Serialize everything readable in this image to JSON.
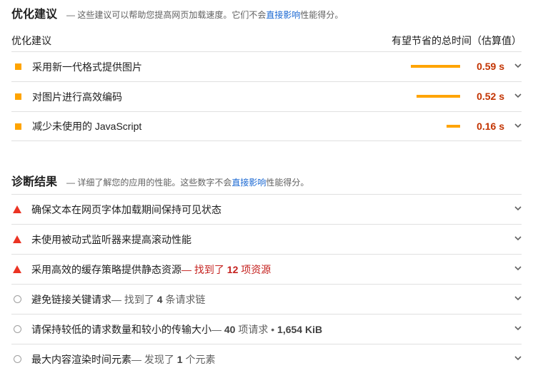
{
  "opportunities": {
    "title": "优化建议",
    "desc_before": "— 这些建议可以帮助您提高网页加载速度。它们不会",
    "desc_link": "直接影响",
    "desc_after": "性能得分。",
    "col_left": "优化建议",
    "col_right": "有望节省的总时间（估算值）",
    "items": [
      {
        "label": "采用新一代格式提供图片",
        "saving": "0.59 s",
        "savings_seconds": 0.59
      },
      {
        "label": "对图片进行高效编码",
        "saving": "0.52 s",
        "savings_seconds": 0.52
      },
      {
        "label": "减少未使用的 JavaScript",
        "saving": "0.16 s",
        "savings_seconds": 0.16
      }
    ],
    "status_color": "#ffa400",
    "saving_text_color": "#c33300"
  },
  "diagnostics": {
    "title": "诊断结果",
    "desc_before": "— 详细了解您的应用的性能。这些数字不会",
    "desc_link": "直接影响",
    "desc_after": "性能得分。",
    "items": [
      {
        "icon": "fail-triangle-icon",
        "label": "确保文本在网页字体加载期间保持可见状态"
      },
      {
        "icon": "fail-triangle-icon",
        "label": "未使用被动式监听器来提高滚动性能"
      },
      {
        "icon": "fail-triangle-icon",
        "label": "采用高效的缓存策略提供静态资源",
        "suffix_pre": " — 找到了 ",
        "suffix_num": "12",
        "suffix_post": " 项资源"
      },
      {
        "icon": "info-circle-icon",
        "label": "避免链接关键请求",
        "suffix_pre": " — 找到了 ",
        "suffix_num": "4",
        "suffix_post": " 条请求链"
      },
      {
        "icon": "info-circle-icon",
        "label": "请保持较低的请求数量和较小的传输大小",
        "suffix_pre": " — ",
        "suffix_num": "40",
        "suffix_post": " 项请求 • ",
        "suffix_num2": "1,654 KiB"
      },
      {
        "icon": "info-circle-icon",
        "label": "最大内容渲染时间元素",
        "suffix_pre": " — 发现了 ",
        "suffix_num": "1",
        "suffix_post": " 个元素"
      }
    ],
    "fail_color": "#eb3323",
    "warn_text_color": "#c5221f"
  }
}
